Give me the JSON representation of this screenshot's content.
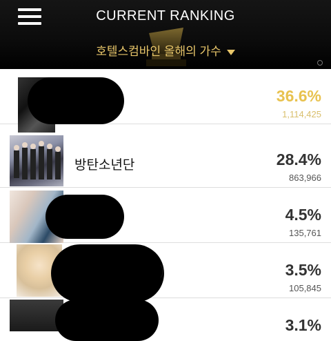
{
  "header": {
    "title": "CURRENT RANKING",
    "category": "호텔스컴바인 올해의 가수",
    "menu_icon": "hamburger-menu-icon",
    "dropdown_icon": "caret-down-icon",
    "trophy_icon": "trophy-icon"
  },
  "colors": {
    "top_percentage": "#e8c24f",
    "header_bg": "#0b0b0b"
  },
  "ranking": [
    {
      "name": "",
      "percent": "36.6%",
      "votes": "1,114,425"
    },
    {
      "name": "방탄소년단",
      "percent": "28.4%",
      "votes": "863,966"
    },
    {
      "name": "",
      "percent": "4.5%",
      "votes": "135,761"
    },
    {
      "name": ")",
      "percent": "3.5%",
      "votes": "105,845"
    },
    {
      "name": "",
      "percent": "3.1%",
      "votes": ""
    }
  ]
}
